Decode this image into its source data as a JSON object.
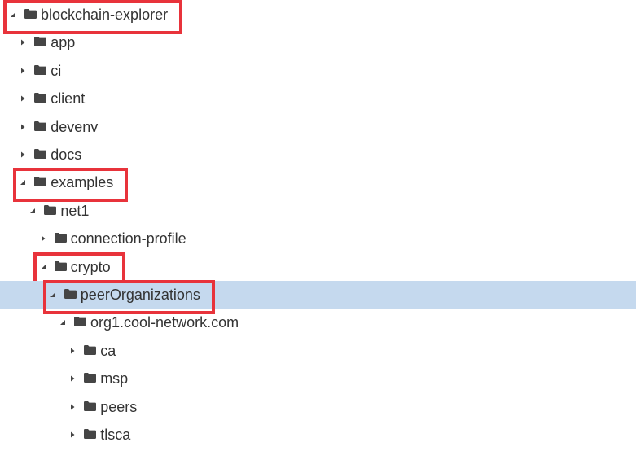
{
  "accent": {
    "selection_background": "#c5d9ee",
    "annotation_color": "#e8333b",
    "text_color": "#333333",
    "icon_color": "#454545"
  },
  "tree": {
    "items": [
      {
        "label": "blockchain-explorer",
        "depth": 0,
        "expanded": true,
        "selected": false,
        "annotated": true
      },
      {
        "label": "app",
        "depth": 1,
        "expanded": false,
        "selected": false,
        "annotated": false
      },
      {
        "label": "ci",
        "depth": 1,
        "expanded": false,
        "selected": false,
        "annotated": false
      },
      {
        "label": "client",
        "depth": 1,
        "expanded": false,
        "selected": false,
        "annotated": false
      },
      {
        "label": "devenv",
        "depth": 1,
        "expanded": false,
        "selected": false,
        "annotated": false
      },
      {
        "label": "docs",
        "depth": 1,
        "expanded": false,
        "selected": false,
        "annotated": false
      },
      {
        "label": "examples",
        "depth": 1,
        "expanded": true,
        "selected": false,
        "annotated": true
      },
      {
        "label": "net1",
        "depth": 2,
        "expanded": true,
        "selected": false,
        "annotated": false
      },
      {
        "label": "connection-profile",
        "depth": 3,
        "expanded": false,
        "selected": false,
        "annotated": false
      },
      {
        "label": "crypto",
        "depth": 3,
        "expanded": true,
        "selected": false,
        "annotated": true
      },
      {
        "label": "peerOrganizations",
        "depth": 4,
        "expanded": true,
        "selected": true,
        "annotated": true
      },
      {
        "label": "org1.cool-network.com",
        "depth": 5,
        "expanded": true,
        "selected": false,
        "annotated": false
      },
      {
        "label": "ca",
        "depth": 6,
        "expanded": false,
        "selected": false,
        "annotated": false
      },
      {
        "label": "msp",
        "depth": 6,
        "expanded": false,
        "selected": false,
        "annotated": false
      },
      {
        "label": "peers",
        "depth": 6,
        "expanded": false,
        "selected": false,
        "annotated": false
      },
      {
        "label": "tlsca",
        "depth": 6,
        "expanded": false,
        "selected": false,
        "annotated": false
      }
    ]
  },
  "icons": {
    "expanded": "triangle-down-icon",
    "collapsed": "triangle-right-icon",
    "folder": "folder-icon"
  }
}
